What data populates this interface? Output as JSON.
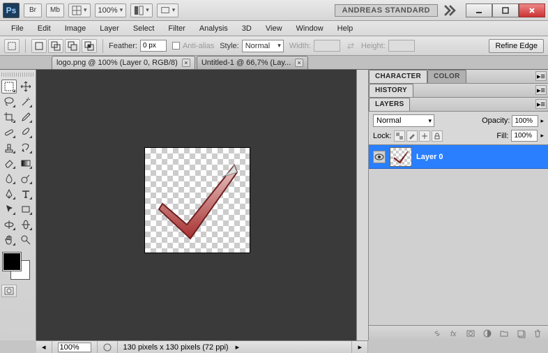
{
  "title": {
    "workspace": "ANDREAS STANDARD",
    "zoom": "100%"
  },
  "menu": [
    "File",
    "Edit",
    "Image",
    "Layer",
    "Select",
    "Filter",
    "Analysis",
    "3D",
    "View",
    "Window",
    "Help"
  ],
  "options": {
    "feather_label": "Feather:",
    "feather_value": "0 px",
    "antialias": "Anti-alias",
    "style_label": "Style:",
    "style_value": "Normal",
    "width_label": "Width:",
    "height_label": "Height:",
    "refine": "Refine Edge"
  },
  "tabs": [
    {
      "label": "logo.png @ 100% (Layer 0, RGB/8)",
      "active": true
    },
    {
      "label": "Untitled-1 @ 66,7% (Lay...",
      "active": false
    }
  ],
  "panels": {
    "character": "CHARACTER",
    "color": "COLOR",
    "history": "HISTORY",
    "layers": "LAYERS",
    "blend_mode": "Normal",
    "opacity_label": "Opacity:",
    "opacity_value": "100%",
    "lock_label": "Lock:",
    "fill_label": "Fill:",
    "fill_value": "100%",
    "layer0": "Layer 0"
  },
  "status": {
    "zoom": "100%",
    "doc_info": "130 pixels x 130 pixels (72 ppi)"
  }
}
